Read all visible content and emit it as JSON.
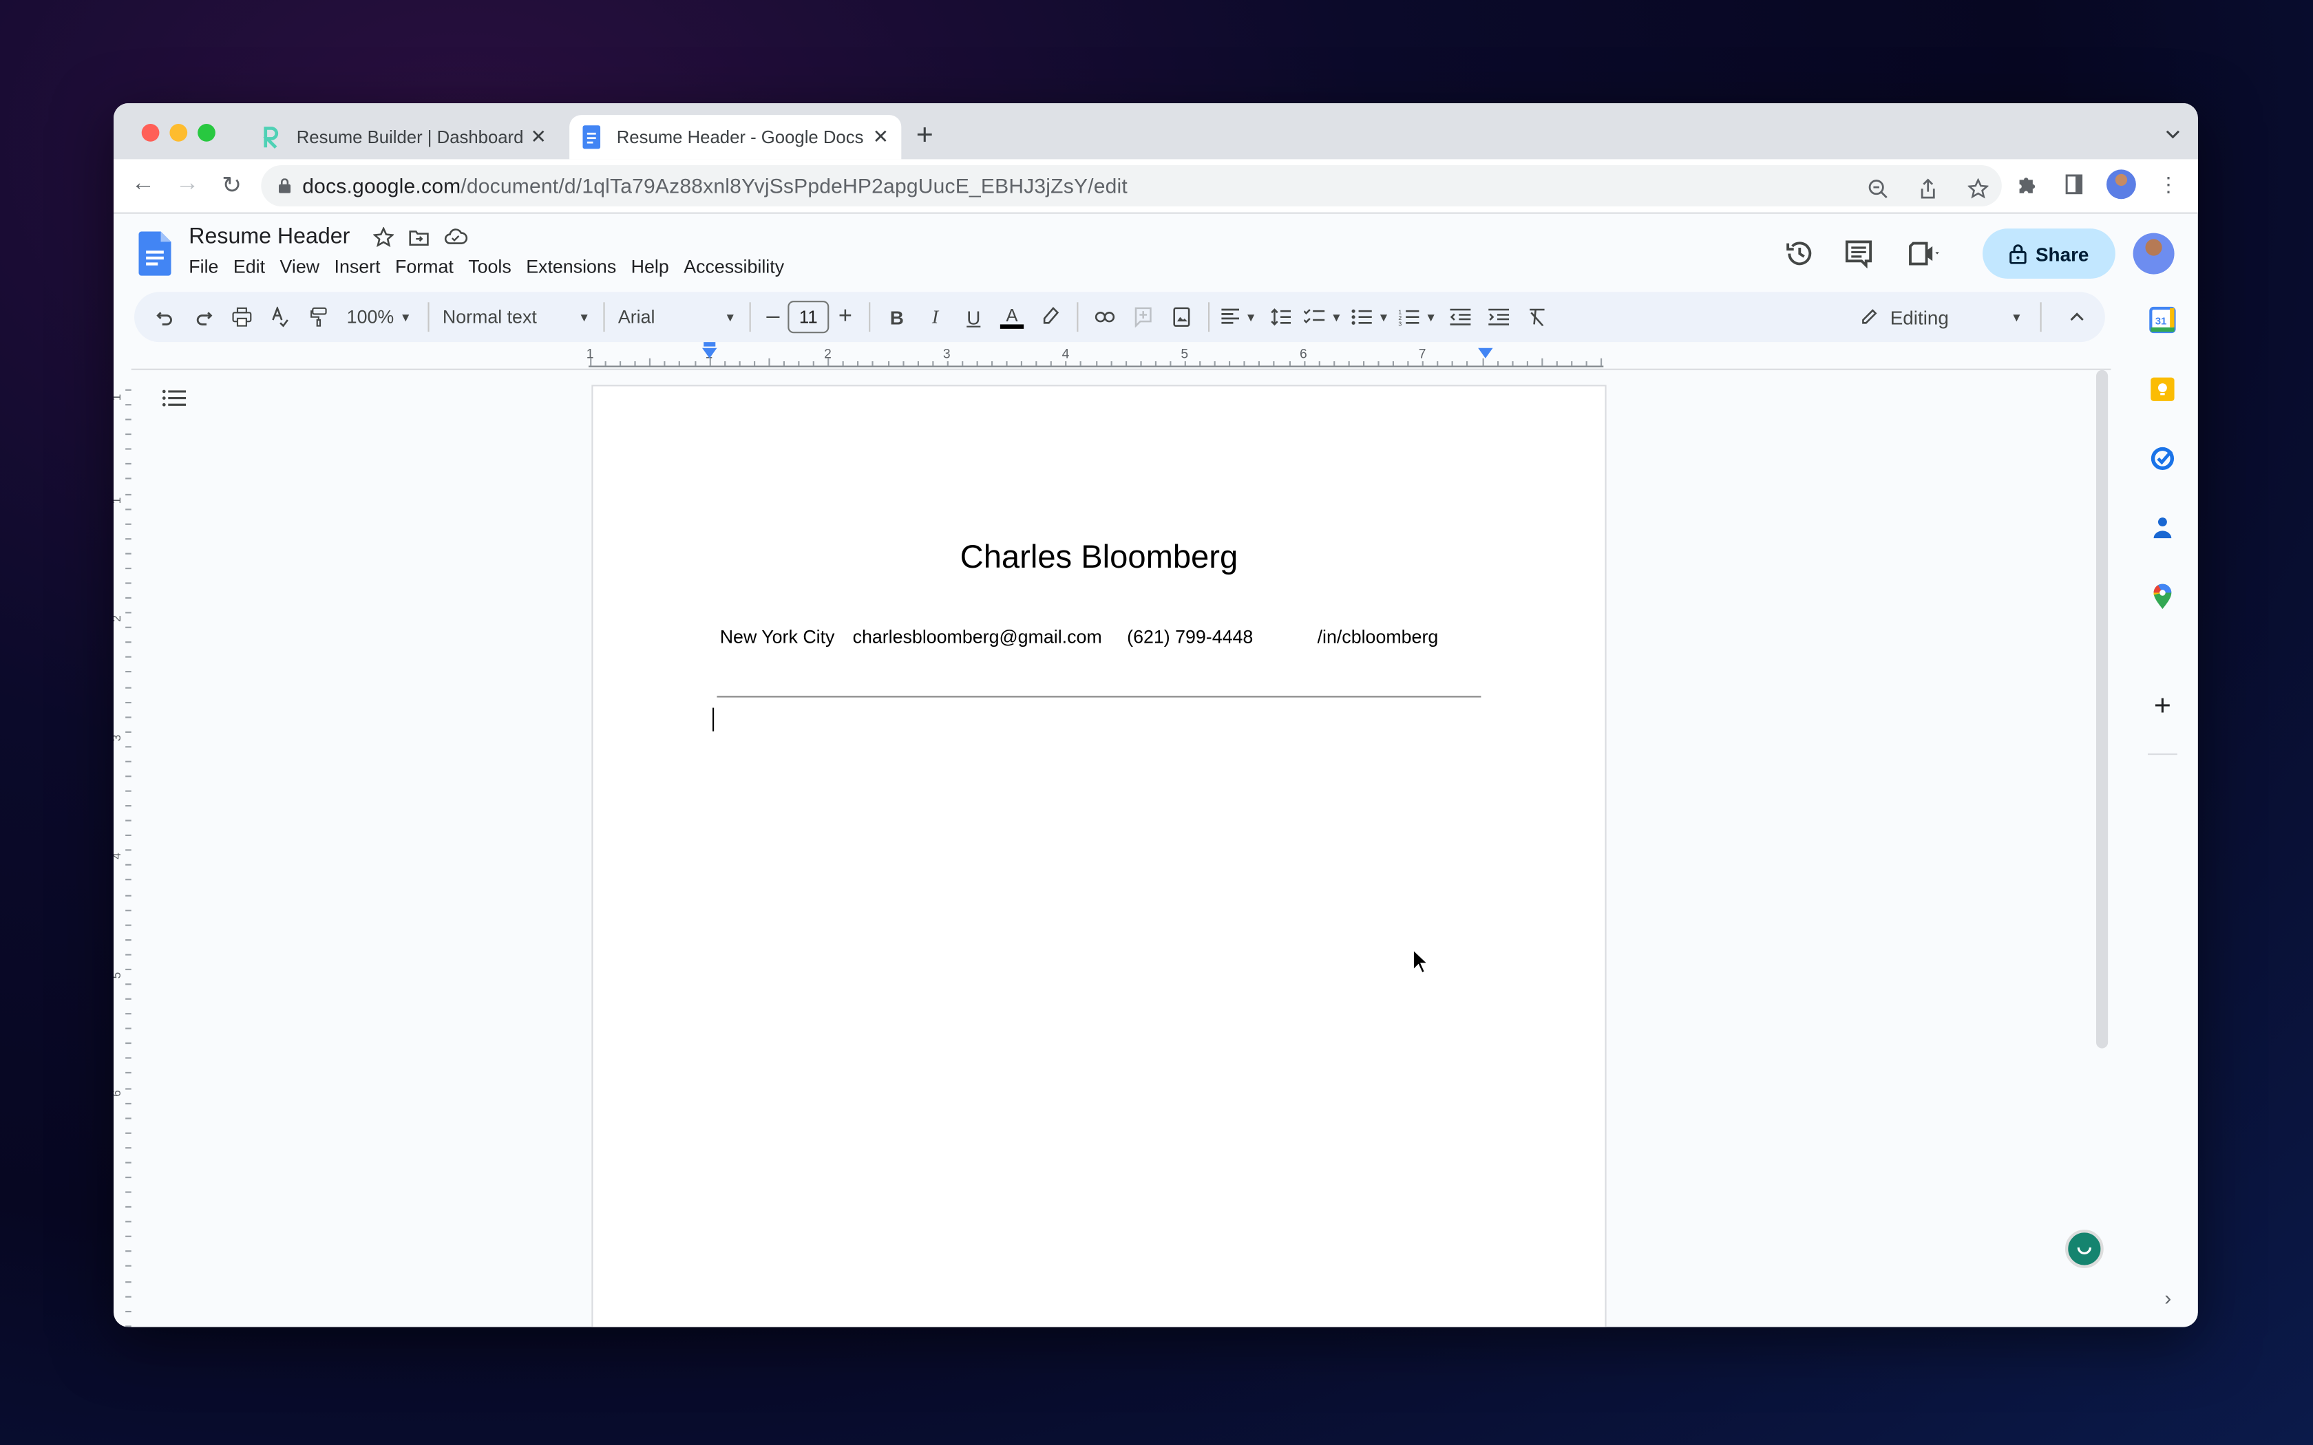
{
  "browser": {
    "tabs": [
      {
        "title": "Resume Builder | Dashboard",
        "icon": "resume-builder-icon",
        "active": false
      },
      {
        "title": "Resume Header - Google Docs",
        "icon": "google-docs-icon",
        "active": true
      }
    ],
    "new_tab_label": "+",
    "url_host": "docs.google.com",
    "url_path": "/document/d/1qlTa79Az88xnl8YvjSsPpdeHP2apgUucE_EBHJ3jZsY/edit"
  },
  "docs": {
    "title": "Resume Header",
    "menu": [
      "File",
      "Edit",
      "View",
      "Insert",
      "Format",
      "Tools",
      "Extensions",
      "Help",
      "Accessibility"
    ],
    "share_label": "Share",
    "toolbar": {
      "zoom": "100%",
      "style": "Normal text",
      "font": "Arial",
      "font_size": "11",
      "mode": "Editing"
    },
    "ruler_labels": [
      "1",
      "1",
      "2",
      "3",
      "4",
      "5",
      "6",
      "7"
    ],
    "vruler_labels": [
      "1",
      "1",
      "2",
      "3",
      "4",
      "5",
      "6"
    ]
  },
  "document": {
    "name": "Charles Bloomberg",
    "contact": {
      "city": "New York City",
      "email": "charlesbloomberg@gmail.com",
      "phone": "(621) 799-4448",
      "linkedin": "/in/cbloomberg"
    }
  },
  "colors": {
    "share_bg": "#c2e7ff",
    "docs_blue": "#4285f4",
    "grammarly": "#15846f"
  }
}
